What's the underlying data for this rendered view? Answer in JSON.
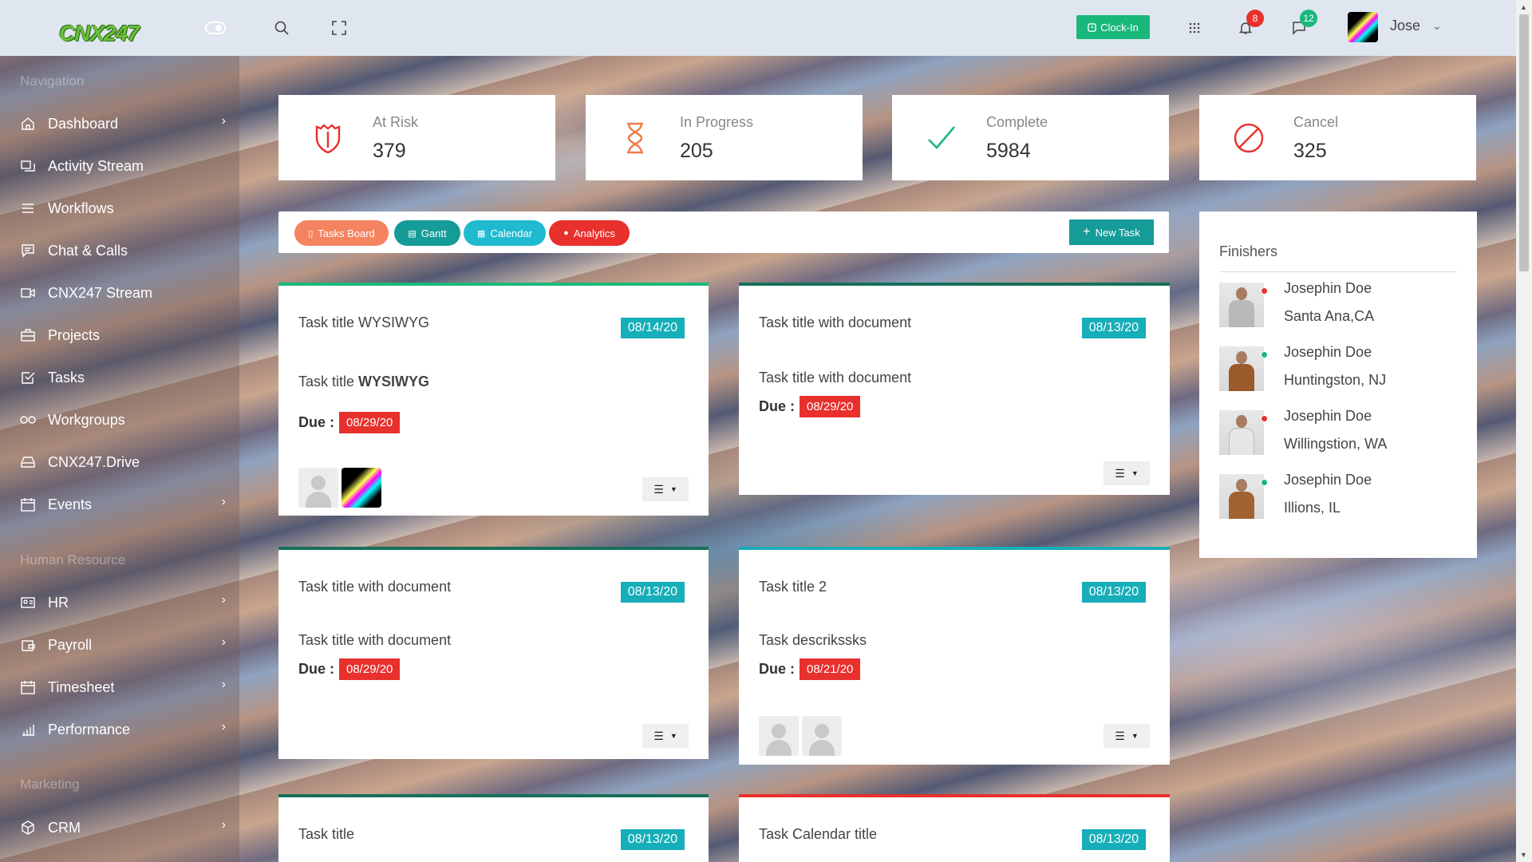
{
  "header": {
    "logo_text": "CNX247",
    "clock_in_label": "Clock-In",
    "notifications_count": "8",
    "messages_count": "12",
    "user_name": "Jose"
  },
  "sidebar": {
    "section_navigation": "Navigation",
    "section_hr": "Human Resource",
    "section_marketing": "Marketing",
    "items": [
      {
        "label": "Dashboard",
        "icon": "home-icon"
      },
      {
        "label": "Activity Stream",
        "icon": "stream-icon"
      },
      {
        "label": "Workflows",
        "icon": "menu-icon"
      },
      {
        "label": "Chat & Calls",
        "icon": "chat-icon"
      },
      {
        "label": "CNX247 Stream",
        "icon": "video-icon"
      },
      {
        "label": "Projects",
        "icon": "briefcase-icon"
      },
      {
        "label": "Tasks",
        "icon": "checkbox-icon"
      },
      {
        "label": "Workgroups",
        "icon": "infinity-icon"
      },
      {
        "label": "CNX247.Drive",
        "icon": "drive-icon"
      },
      {
        "label": "Events",
        "icon": "calendar-icon"
      },
      {
        "label": "HR",
        "icon": "id-card-icon"
      },
      {
        "label": "Payroll",
        "icon": "wallet-icon"
      },
      {
        "label": "Timesheet",
        "icon": "calendar-icon"
      },
      {
        "label": "Performance",
        "icon": "bar-chart-icon"
      },
      {
        "label": "CRM",
        "icon": "box-icon"
      }
    ]
  },
  "stats": [
    {
      "label": "At Risk",
      "value": "379",
      "color": "#e8302d"
    },
    {
      "label": "In Progress",
      "value": "205",
      "color": "#f07a4a"
    },
    {
      "label": "Complete",
      "value": "5984",
      "color": "#19b87a"
    },
    {
      "label": "Cancel",
      "value": "325",
      "color": "#e8302d"
    }
  ],
  "tabs": [
    {
      "label": "Tasks Board",
      "color": "#f4845f"
    },
    {
      "label": "Gantt",
      "color": "#159c98"
    },
    {
      "label": "Calendar",
      "color": "#1fbad0"
    },
    {
      "label": "Analytics",
      "color": "#e8302d"
    }
  ],
  "new_task_label": "New Task",
  "due_label": "Due :",
  "tasks": [
    {
      "title": "Task title WYSIWYG",
      "date": "08/14/20",
      "desc_plain": "Task title ",
      "desc_bold": "WYSIWYG",
      "due": "08/29/20"
    },
    {
      "title": "Task title with document",
      "date": "08/13/20",
      "desc": "Task title with document",
      "due": "08/29/20"
    },
    {
      "title": "Task title with document",
      "date": "08/13/20",
      "desc": "Task title with document",
      "due": "08/29/20"
    },
    {
      "title": "Task title 2",
      "date": "08/13/20",
      "desc": "Task descrikssks",
      "due": "08/21/20"
    },
    {
      "title": "Task title",
      "date": "08/13/20"
    },
    {
      "title": "Task Calendar title",
      "date": "08/13/20"
    }
  ],
  "finishers": {
    "title": "Finishers",
    "people": [
      {
        "name": "Josephin Doe",
        "location": "Santa Ana,CA",
        "status_color": "#e8302d"
      },
      {
        "name": "Josephin Doe",
        "location": "Huntingston, NJ",
        "status_color": "#19b87a"
      },
      {
        "name": "Josephin Doe",
        "location": "Willingstion, WA",
        "status_color": "#e8302d"
      },
      {
        "name": "Josephin Doe",
        "location": "Illions, IL",
        "status_color": "#19b87a"
      }
    ]
  }
}
